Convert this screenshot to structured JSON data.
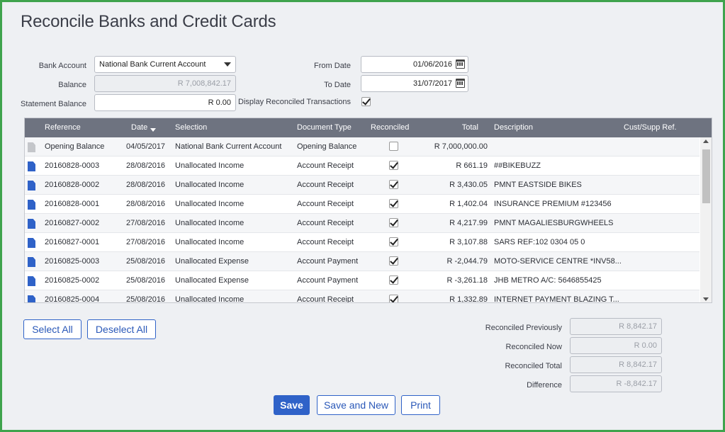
{
  "page": {
    "title": "Reconcile Banks and Credit Cards"
  },
  "form": {
    "bank_account_label": "Bank Account",
    "bank_account_value": "National Bank Current Account",
    "balance_label": "Balance",
    "balance_value": "R 7,008,842.17",
    "statement_balance_label": "Statement Balance",
    "statement_balance_value": "R 0.00",
    "from_date_label": "From Date",
    "from_date_value": "01/06/2016",
    "to_date_label": "To Date",
    "to_date_value": "31/07/2017",
    "display_reconciled_label": "Display Reconciled Transactions",
    "display_reconciled_checked": true
  },
  "grid": {
    "columns": {
      "reference": "Reference",
      "date": "Date",
      "selection": "Selection",
      "document_type": "Document Type",
      "reconciled": "Reconciled",
      "total": "Total",
      "description": "Description",
      "cust_supp_ref": "Cust/Supp Ref."
    },
    "rows": [
      {
        "icon": "document-grey-icon",
        "reference": "Opening Balance",
        "date": "04/05/2017",
        "selection": "National Bank Current Account",
        "document_type": "Opening Balance",
        "reconciled": false,
        "total": "R 7,000,000.00",
        "description": "",
        "cust_supp_ref": ""
      },
      {
        "icon": "document-icon",
        "reference": "20160828-0003",
        "date": "28/08/2016",
        "selection": "Unallocated Income",
        "document_type": "Account Receipt",
        "reconciled": true,
        "total": "R 661.19",
        "description": "##BIKEBUZZ",
        "cust_supp_ref": ""
      },
      {
        "icon": "document-icon",
        "reference": "20160828-0002",
        "date": "28/08/2016",
        "selection": "Unallocated Income",
        "document_type": "Account Receipt",
        "reconciled": true,
        "total": "R 3,430.05",
        "description": "PMNT EASTSIDE BIKES",
        "cust_supp_ref": ""
      },
      {
        "icon": "document-icon",
        "reference": "20160828-0001",
        "date": "28/08/2016",
        "selection": "Unallocated Income",
        "document_type": "Account Receipt",
        "reconciled": true,
        "total": "R 1,402.04",
        "description": "INSURANCE PREMIUM #123456",
        "cust_supp_ref": ""
      },
      {
        "icon": "document-icon",
        "reference": "20160827-0002",
        "date": "27/08/2016",
        "selection": "Unallocated Income",
        "document_type": "Account Receipt",
        "reconciled": true,
        "total": "R 4,217.99",
        "description": "PMNT MAGALIESBURGWHEELS",
        "cust_supp_ref": ""
      },
      {
        "icon": "document-icon",
        "reference": "20160827-0001",
        "date": "27/08/2016",
        "selection": "Unallocated Income",
        "document_type": "Account Receipt",
        "reconciled": true,
        "total": "R 3,107.88",
        "description": "SARS REF:102 0304 05 0",
        "cust_supp_ref": ""
      },
      {
        "icon": "document-icon",
        "reference": "20160825-0003",
        "date": "25/08/2016",
        "selection": "Unallocated Expense",
        "document_type": "Account Payment",
        "reconciled": true,
        "total": "R -2,044.79",
        "description": "MOTO-SERVICE CENTRE *INV58...",
        "cust_supp_ref": ""
      },
      {
        "icon": "document-icon",
        "reference": "20160825-0002",
        "date": "25/08/2016",
        "selection": "Unallocated Expense",
        "document_type": "Account Payment",
        "reconciled": true,
        "total": "R -3,261.18",
        "description": "JHB METRO A/C: 5646855425",
        "cust_supp_ref": ""
      },
      {
        "icon": "document-icon",
        "reference": "20160825-0004",
        "date": "25/08/2016",
        "selection": "Unallocated Income",
        "document_type": "Account Receipt",
        "reconciled": true,
        "total": "R 1,332.89",
        "description": "INTERNET PAYMENT BLAZING T...",
        "cust_supp_ref": ""
      }
    ]
  },
  "actions": {
    "select_all": "Select All",
    "deselect_all": "Deselect All",
    "save": "Save",
    "save_and_new": "Save and New",
    "print": "Print"
  },
  "summary": {
    "reconciled_previously_label": "Reconciled Previously",
    "reconciled_previously_value": "R 8,842.17",
    "reconciled_now_label": "Reconciled Now",
    "reconciled_now_value": "R 0.00",
    "reconciled_total_label": "Reconciled Total",
    "reconciled_total_value": "R 8,842.17",
    "difference_label": "Difference",
    "difference_value": "R -8,842.17"
  },
  "colors": {
    "accent": "#2f62c8",
    "header_bg": "#6e7380",
    "frame_border": "#3fa34d",
    "page_bg": "#eef0f3"
  }
}
